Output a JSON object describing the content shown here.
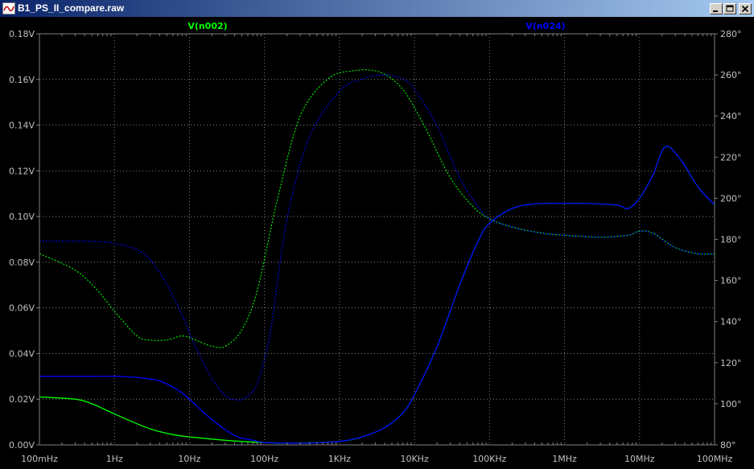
{
  "window": {
    "title": "B1_PS_II_compare.raw",
    "icons": [
      "waveform-icon",
      "minimize-icon",
      "maximize-icon",
      "close-icon"
    ]
  },
  "chart_data": {
    "type": "line",
    "background": "#000000",
    "x_axis": {
      "scale": "log",
      "range_hz": [
        0.1,
        100000000
      ],
      "ticks": [
        {
          "value": 0.1,
          "label": "100mHz"
        },
        {
          "value": 1,
          "label": "1Hz"
        },
        {
          "value": 10,
          "label": "10Hz"
        },
        {
          "value": 100,
          "label": "100Hz"
        },
        {
          "value": 1000,
          "label": "1KHz"
        },
        {
          "value": 10000,
          "label": "10KHz"
        },
        {
          "value": 100000,
          "label": "100KHz"
        },
        {
          "value": 1000000,
          "label": "1MHz"
        },
        {
          "value": 10000000,
          "label": "10MHz"
        },
        {
          "value": 100000000,
          "label": "100MHz"
        }
      ]
    },
    "y_left": {
      "range": [
        0,
        0.18
      ],
      "ticks": [
        {
          "value": 0.18,
          "label": "0.18V"
        },
        {
          "value": 0.16,
          "label": "0.16V"
        },
        {
          "value": 0.14,
          "label": "0.14V"
        },
        {
          "value": 0.12,
          "label": "0.12V"
        },
        {
          "value": 0.1,
          "label": "0.10V"
        },
        {
          "value": 0.08,
          "label": "0.08V"
        },
        {
          "value": 0.06,
          "label": "0.06V"
        },
        {
          "value": 0.04,
          "label": "0.04V"
        },
        {
          "value": 0.02,
          "label": "0.02V"
        },
        {
          "value": 0.0,
          "label": "0.00V"
        }
      ]
    },
    "y_right": {
      "range": [
        80,
        280
      ],
      "ticks": [
        {
          "value": 280,
          "label": "280°"
        },
        {
          "value": 260,
          "label": "260°"
        },
        {
          "value": 240,
          "label": "240°"
        },
        {
          "value": 220,
          "label": "220°"
        },
        {
          "value": 200,
          "label": "200°"
        },
        {
          "value": 180,
          "label": "180°"
        },
        {
          "value": 160,
          "label": "160°"
        },
        {
          "value": 140,
          "label": "140°"
        },
        {
          "value": 120,
          "label": "120°"
        },
        {
          "value": 100,
          "label": "100°"
        },
        {
          "value": 80,
          "label": "80°"
        }
      ]
    },
    "grid": true,
    "grid_color": "#808080",
    "tick_label_color": "#c0c0c0",
    "legend": [
      {
        "label": "V(n002)",
        "color": "#00ff00",
        "position": "top-left"
      },
      {
        "label": "V(n024)",
        "color": "#0000ff",
        "position": "top-right"
      }
    ],
    "series": [
      {
        "name": "V(n002)",
        "quantity": "magnitude",
        "color": "#00ff00",
        "style": "solid",
        "axis": "left",
        "x": [
          0.1,
          0.3,
          0.5,
          0.8,
          1.5,
          3,
          6,
          10,
          30,
          100,
          300,
          1000,
          2000,
          4000,
          7000,
          10000,
          20000,
          40000,
          70000,
          100000,
          200000,
          400000,
          1000000,
          2000000,
          5000000,
          7000000,
          10000000,
          15000000,
          22000000,
          35000000,
          60000000,
          100000000
        ],
        "values": [
          0.021,
          0.02,
          0.018,
          0.015,
          0.011,
          0.007,
          0.0045,
          0.0035,
          0.002,
          0.001,
          0.0008,
          0.0015,
          0.0035,
          0.0075,
          0.014,
          0.022,
          0.043,
          0.07,
          0.089,
          0.097,
          0.1035,
          0.1055,
          0.1058,
          0.1057,
          0.105,
          0.1035,
          0.108,
          0.118,
          0.1305,
          0.125,
          0.113,
          0.105
        ]
      },
      {
        "name": "V(n024)",
        "quantity": "magnitude",
        "color": "#0000ff",
        "style": "solid",
        "axis": "left",
        "x": [
          0.1,
          0.5,
          1,
          2,
          4,
          7,
          10,
          20,
          40,
          70,
          100,
          200,
          400,
          1000,
          2000,
          4000,
          7000,
          10000,
          20000,
          40000,
          70000,
          100000,
          200000,
          400000,
          1000000,
          2000000,
          5000000,
          7000000,
          10000000,
          15000000,
          22000000,
          35000000,
          60000000,
          100000000
        ],
        "values": [
          0.03,
          0.03,
          0.03,
          0.0295,
          0.028,
          0.024,
          0.02,
          0.011,
          0.004,
          0.002,
          0.001,
          0.0008,
          0.0008,
          0.0015,
          0.0035,
          0.0075,
          0.014,
          0.022,
          0.043,
          0.07,
          0.089,
          0.097,
          0.1035,
          0.1055,
          0.1058,
          0.1057,
          0.105,
          0.1035,
          0.108,
          0.118,
          0.1305,
          0.125,
          0.113,
          0.105
        ]
      },
      {
        "name": "V(n002)",
        "quantity": "phase",
        "color": "#00ff00",
        "style": "dotted",
        "axis": "right",
        "x": [
          0.1,
          0.3,
          0.6,
          1,
          2,
          3,
          5,
          8,
          12,
          20,
          30,
          50,
          80,
          150,
          300,
          700,
          1500,
          3000,
          5000,
          8000,
          15000,
          30000,
          60000,
          100000,
          200000,
          500000,
          1000000,
          3000000,
          7000000,
          10000000,
          15000000,
          30000000,
          60000000,
          100000000
        ],
        "values": [
          173,
          165,
          155,
          145,
          133,
          131,
          131,
          133,
          131,
          128,
          128,
          136,
          155,
          200,
          240,
          258,
          262,
          262,
          258,
          250,
          232,
          210,
          196,
          190,
          186,
          183,
          182,
          181,
          182,
          184,
          183,
          176,
          173,
          173
        ]
      },
      {
        "name": "V(n024)",
        "quantity": "phase",
        "color": "#0000ff",
        "style": "dotted",
        "axis": "right",
        "x": [
          0.1,
          0.5,
          1,
          2,
          3,
          5,
          8,
          12,
          20,
          30,
          40,
          50,
          60,
          80,
          120,
          200,
          400,
          1000,
          2000,
          4000,
          7000,
          10000,
          20000,
          40000,
          70000,
          100000,
          200000,
          500000,
          1000000,
          3000000,
          7000000,
          10000000,
          15000000,
          30000000,
          60000000,
          100000000
        ],
        "values": [
          179,
          179,
          178,
          175,
          170,
          158,
          143,
          128,
          112,
          104,
          102,
          102,
          104,
          110,
          135,
          190,
          230,
          252,
          258,
          260,
          258,
          253,
          235,
          210,
          196,
          190,
          186,
          183,
          182,
          181,
          182,
          184,
          183,
          176,
          173,
          173
        ]
      }
    ]
  }
}
